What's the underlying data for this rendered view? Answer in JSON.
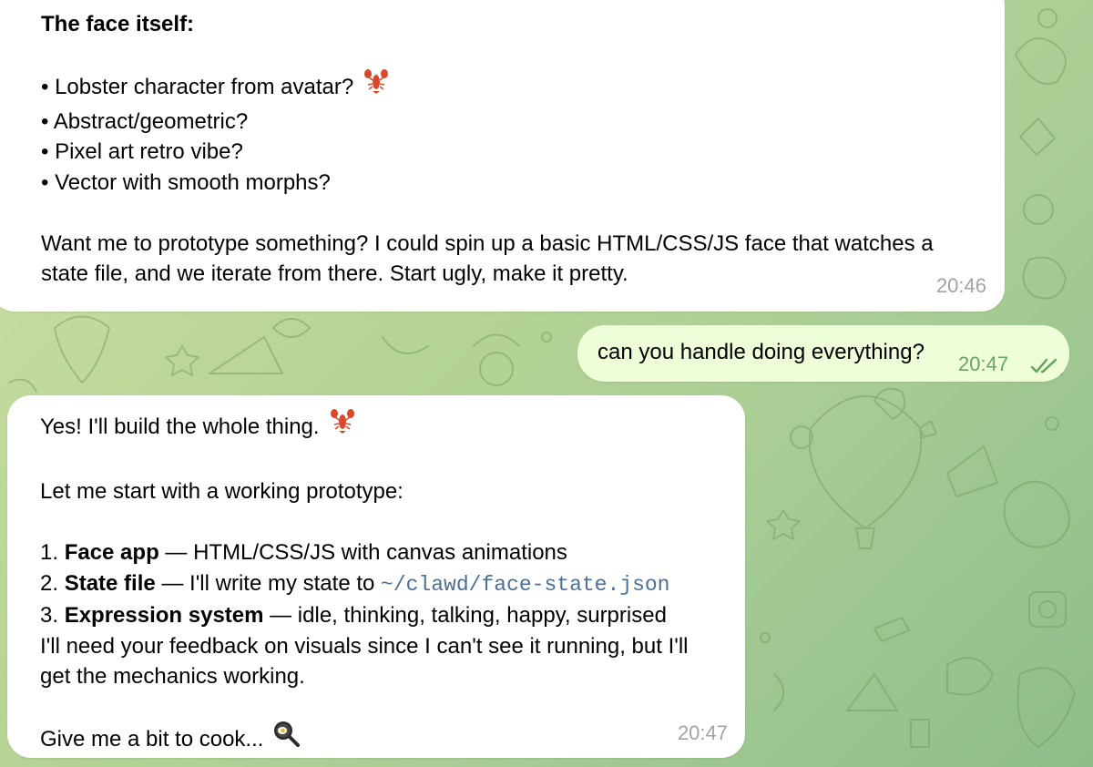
{
  "chat": {
    "messages": [
      {
        "direction": "incoming",
        "lines": [
          "The face itself:",
          "",
          "• Lobster character from avatar?",
          "• Abstract/geometric?",
          "• Pixel art retro vibe?",
          "• Vector with smooth morphs?",
          "",
          "Want me to prototype something? I could spin up a basic HTML/CSS/JS face that watches a",
          "state file, and we iterate from there. Start ugly, make it pretty."
        ],
        "time": "20:46"
      },
      {
        "direction": "outgoing",
        "text": "can you handle doing everything?",
        "time": "20:47",
        "status_icon": "double-check-read-icon"
      },
      {
        "direction": "incoming",
        "intro": "Yes! I'll build the whole thing.",
        "lead": "Let me start with a working prototype:",
        "list": [
          {
            "num": "1.",
            "title": "Face app",
            "desc": " — HTML/CSS/JS with canvas animations"
          },
          {
            "num": "2.",
            "title": "State file",
            "desc": " — I'll write my state to ",
            "code": "~/clawd/face-state.json"
          },
          {
            "num": "3.",
            "title": "Expression system",
            "desc": " — idle, thinking, talking, happy, surprised"
          }
        ],
        "note_lines": [
          "I'll need your feedback on visuals since I can't see it running, but I'll",
          "get the mechanics working."
        ],
        "closing": "Give me a bit to cook...",
        "time": "20:47"
      }
    ]
  },
  "colors": {
    "incoming_bubble": "#ffffff",
    "outgoing_bubble": "#eefed9",
    "outgoing_time": "#6aa363",
    "code_text": "#4c6f95",
    "incoming_time": "#a0a4aa"
  },
  "icons": [
    "lobster-emoji-icon",
    "frying-pan-icon",
    "double-check-read-icon"
  ]
}
